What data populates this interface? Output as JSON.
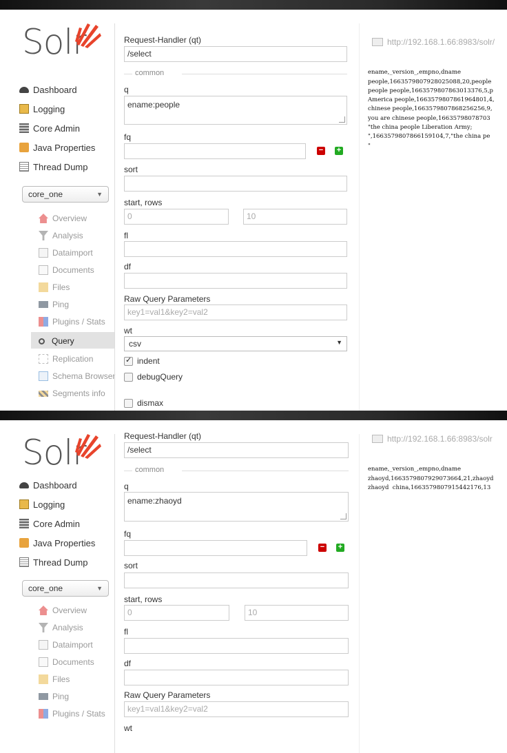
{
  "shots": [
    {
      "logo": "Solr",
      "nav": [
        {
          "label": "Dashboard",
          "icon": "dashboard-icon"
        },
        {
          "label": "Logging",
          "icon": "logging-icon"
        },
        {
          "label": "Core Admin",
          "icon": "core-admin-icon"
        },
        {
          "label": "Java Properties",
          "icon": "java-icon"
        },
        {
          "label": "Thread Dump",
          "icon": "thread-dump-icon"
        }
      ],
      "core_selector": "core_one",
      "core_menu": [
        {
          "label": "Overview",
          "icon": "overview-icon"
        },
        {
          "label": "Analysis",
          "icon": "analysis-icon"
        },
        {
          "label": "Dataimport",
          "icon": "dataimport-icon"
        },
        {
          "label": "Documents",
          "icon": "documents-icon"
        },
        {
          "label": "Files",
          "icon": "files-icon"
        },
        {
          "label": "Ping",
          "icon": "ping-icon"
        },
        {
          "label": "Plugins / Stats",
          "icon": "plugins-icon"
        },
        {
          "label": "Query",
          "icon": "query-icon"
        },
        {
          "label": "Replication",
          "icon": "replication-icon"
        },
        {
          "label": "Schema Browser",
          "icon": "schema-icon"
        },
        {
          "label": "Segments info",
          "icon": "segments-icon"
        }
      ],
      "form": {
        "handler_label": "Request-Handler (qt)",
        "handler_value": "/select",
        "common_legend": "common",
        "q_label": "q",
        "q_value": "ename:people",
        "fq_label": "fq",
        "sort_label": "sort",
        "start_rows_label": "start, rows",
        "start_placeholder": "0",
        "rows_placeholder": "10",
        "fl_label": "fl",
        "df_label": "df",
        "raw_label": "Raw Query Parameters",
        "raw_placeholder": "key1=val1&key2=val2",
        "wt_label": "wt",
        "wt_value": "csv",
        "indent_label": "indent",
        "debug_label": "debugQuery",
        "dismax_label": "dismax"
      },
      "url": "http://192.168.1.66:8983/solr/",
      "response": [
        "ename,_version_,empno,dname",
        "people,1663579807928025088,20,people",
        "people people,1663579807863013376,5,p",
        "America people,1663579807861964801,4,",
        "chinese people,1663579807868256256,9,",
        "you are chinese people,16635798078703",
        "\"the china people Liberation Army;",
        "\",1663579807866159104,7,\"the china pe",
        "\""
      ]
    },
    {
      "logo": "Solr",
      "nav": [
        {
          "label": "Dashboard",
          "icon": "dashboard-icon"
        },
        {
          "label": "Logging",
          "icon": "logging-icon"
        },
        {
          "label": "Core Admin",
          "icon": "core-admin-icon"
        },
        {
          "label": "Java Properties",
          "icon": "java-icon"
        },
        {
          "label": "Thread Dump",
          "icon": "thread-dump-icon"
        }
      ],
      "core_selector": "core_one",
      "core_menu": [
        {
          "label": "Overview",
          "icon": "overview-icon"
        },
        {
          "label": "Analysis",
          "icon": "analysis-icon"
        },
        {
          "label": "Dataimport",
          "icon": "dataimport-icon"
        },
        {
          "label": "Documents",
          "icon": "documents-icon"
        },
        {
          "label": "Files",
          "icon": "files-icon"
        },
        {
          "label": "Ping",
          "icon": "ping-icon"
        },
        {
          "label": "Plugins / Stats",
          "icon": "plugins-icon"
        }
      ],
      "form": {
        "handler_label": "Request-Handler (qt)",
        "handler_value": "/select",
        "common_legend": "common",
        "q_label": "q",
        "q_value": "ename:zhaoyd",
        "fq_label": "fq",
        "sort_label": "sort",
        "start_rows_label": "start, rows",
        "start_placeholder": "0",
        "rows_placeholder": "10",
        "fl_label": "fl",
        "df_label": "df",
        "raw_label": "Raw Query Parameters",
        "raw_placeholder": "key1=val1&key2=val2",
        "wt_label": "wt"
      },
      "url": "http://192.168.1.66:8983/solr",
      "response": [
        "ename,_version_,empno,dname",
        "zhaoyd,1663579807929073664,21,zhaoyd",
        "zhaoyd  china,1663579807915442176,13"
      ]
    }
  ]
}
